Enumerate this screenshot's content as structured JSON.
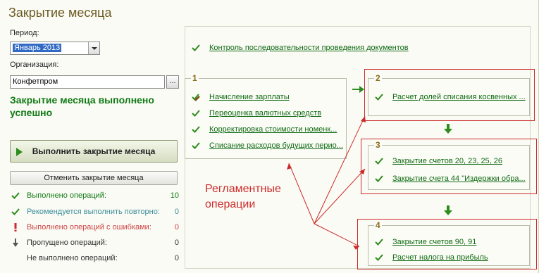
{
  "window": {
    "title": "Закрытие месяца"
  },
  "form": {
    "period_label": "Период:",
    "period_value": "Январь 2013",
    "org_label": "Организация:",
    "org_value": "Конфетпром",
    "org_button": "..."
  },
  "status_message": "Закрытие месяца выполнено успешно",
  "buttons": {
    "run": "Выполнить закрытие месяца",
    "cancel": "Отменить закрытие месяца"
  },
  "stats": [
    {
      "label": "Выполнено операций:",
      "value": "10",
      "icon": "check-icon",
      "color": "#0f7a14"
    },
    {
      "label": "Рекомендуется выполнить повторно:",
      "value": "0",
      "icon": "check-icon",
      "color": "#3b8f9b"
    },
    {
      "label": "Выполнено операций с ошибками:",
      "value": "0",
      "icon": "exclamation-icon",
      "color": "#cc4444"
    },
    {
      "label": "Пропущено операций:",
      "value": "0",
      "icon": "down-arrow-icon",
      "color": "#333333"
    },
    {
      "label": "Не выполнено операций:",
      "value": "0",
      "icon": "none",
      "color": "#333333"
    }
  ],
  "control_op": "Контроль последовательности проведения документов",
  "groups": [
    {
      "number": "1",
      "ops": [
        {
          "label": "Начисление зарплаты",
          "icon": "pencil-check-icon"
        },
        {
          "label": "Переоценка валютных средств",
          "icon": "check-icon"
        },
        {
          "label": "Корректировка стоимости номенк...",
          "icon": "check-icon"
        },
        {
          "label": "Списание расходов будущих перио...",
          "icon": "check-icon"
        }
      ]
    },
    {
      "number": "2",
      "ops": [
        {
          "label": "Расчет долей списания косвенных ...",
          "icon": "check-icon"
        }
      ]
    },
    {
      "number": "3",
      "ops": [
        {
          "label": "Закрытие счетов 20, 23, 25, 26",
          "icon": "check-icon"
        },
        {
          "label": "Закрытие счета 44 \"Издержки обра...",
          "icon": "check-icon"
        }
      ]
    },
    {
      "number": "4",
      "ops": [
        {
          "label": "Закрытие счетов 90, 91",
          "icon": "check-icon"
        },
        {
          "label": "Расчет налога на прибыль",
          "icon": "check-icon"
        }
      ]
    }
  ],
  "annotation": {
    "line1": "Регламентные",
    "line2": "операции"
  },
  "colors": {
    "accent_green": "#0f7a14",
    "title_brown": "#6b5a21",
    "annotation_red": "#cc2a2a"
  }
}
